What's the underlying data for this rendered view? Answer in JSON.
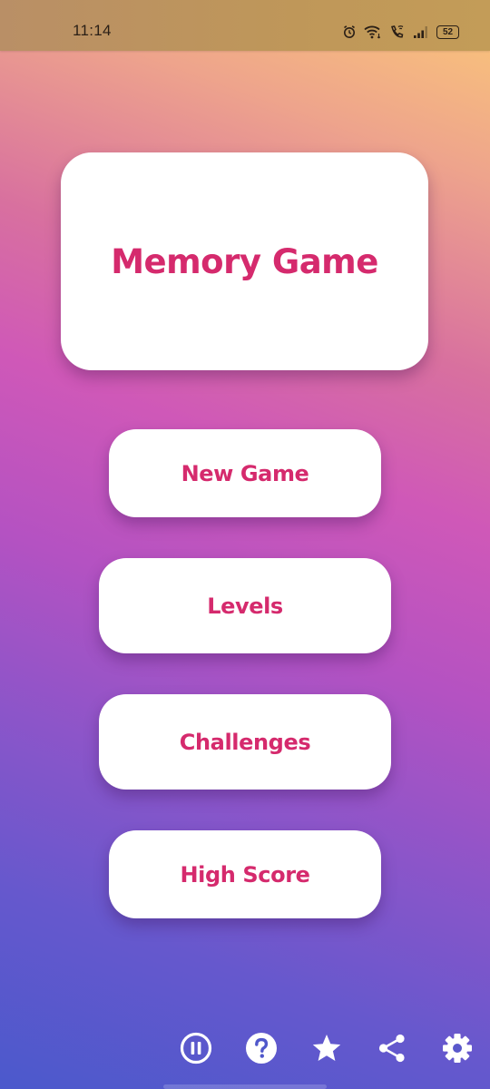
{
  "status_bar": {
    "time": "11:14",
    "icons": [
      "alarm-icon",
      "wifi-icon",
      "wifi-calling-icon",
      "signal-icon",
      "battery-icon"
    ],
    "battery_level": "52"
  },
  "title_card": {
    "title": "Memory Game"
  },
  "menu": {
    "new_game": "New Game",
    "levels": "Levels",
    "challenges": "Challenges",
    "high_score": "High Score"
  },
  "bottom_bar": {
    "icons": [
      "pause-circle-icon",
      "help-icon",
      "star-icon",
      "share-icon",
      "settings-icon"
    ]
  },
  "colors": {
    "accent_text": "#d52a6d",
    "gradient_top": "#fbc878",
    "gradient_middle": "#cf58b8",
    "gradient_bottom": "#4b59cc",
    "status_bar": "#bf9759"
  }
}
